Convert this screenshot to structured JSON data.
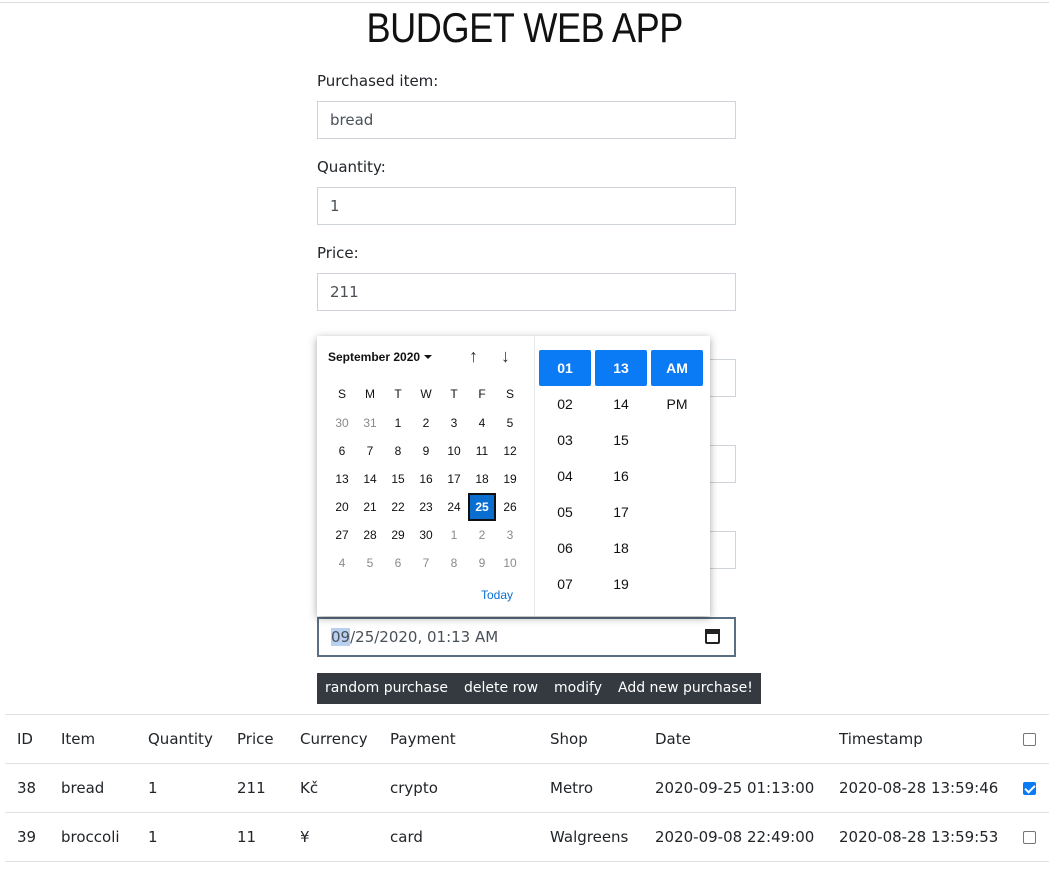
{
  "app_title": "BUDGET WEB APP",
  "form": {
    "item_label": "Purchased item:",
    "item_value": "bread",
    "quantity_label": "Quantity:",
    "quantity_value": "1",
    "price_label": "Price:",
    "price_value": "211",
    "date_value_prefix": "09",
    "date_value_rest": "/25/2020, 01:13 AM"
  },
  "buttons": {
    "random": "random purchase",
    "delete": "delete row",
    "modify": "modify",
    "add": "Add new purchase!"
  },
  "picker": {
    "month": "September 2020",
    "up_arrow": "↑",
    "down_arrow": "↓",
    "weekdays": [
      "S",
      "M",
      "T",
      "W",
      "T",
      "F",
      "S"
    ],
    "weeks": [
      [
        "30",
        "31",
        "1",
        "2",
        "3",
        "4",
        "5"
      ],
      [
        "6",
        "7",
        "8",
        "9",
        "10",
        "11",
        "12"
      ],
      [
        "13",
        "14",
        "15",
        "16",
        "17",
        "18",
        "19"
      ],
      [
        "20",
        "21",
        "22",
        "23",
        "24",
        "25",
        "26"
      ],
      [
        "27",
        "28",
        "29",
        "30",
        "1",
        "2",
        "3"
      ],
      [
        "4",
        "5",
        "6",
        "7",
        "8",
        "9",
        "10"
      ]
    ],
    "selected_day": "25",
    "today_label": "Today",
    "hours": [
      "01",
      "02",
      "03",
      "04",
      "05",
      "06",
      "07"
    ],
    "minutes": [
      "13",
      "14",
      "15",
      "16",
      "17",
      "18",
      "19"
    ],
    "ampm": [
      "AM",
      "PM"
    ],
    "selected_hour": "01",
    "selected_minute": "13",
    "selected_ampm": "AM"
  },
  "table": {
    "headers": [
      "ID",
      "Item",
      "Quantity",
      "Price",
      "Currency",
      "Payment",
      "Shop",
      "Date",
      "Timestamp"
    ],
    "rows": [
      {
        "id": "38",
        "item": "bread",
        "quantity": "1",
        "price": "211",
        "currency": "Kč",
        "payment": "crypto",
        "shop": "Metro",
        "date": "2020-09-25 01:13:00",
        "timestamp": "2020-08-28 13:59:46",
        "checked": true
      },
      {
        "id": "39",
        "item": "broccoli",
        "quantity": "1",
        "price": "11",
        "currency": "¥",
        "payment": "card",
        "shop": "Walgreens",
        "date": "2020-09-08 22:49:00",
        "timestamp": "2020-08-28 13:59:53",
        "checked": false
      }
    ]
  },
  "colors": {
    "accent": "#0a7af5",
    "button_bg": "#343a40"
  },
  "icons": [
    "calendar-icon",
    "arrow-up-icon",
    "arrow-down-icon",
    "caret-down-icon",
    "checkbox-icon"
  ]
}
